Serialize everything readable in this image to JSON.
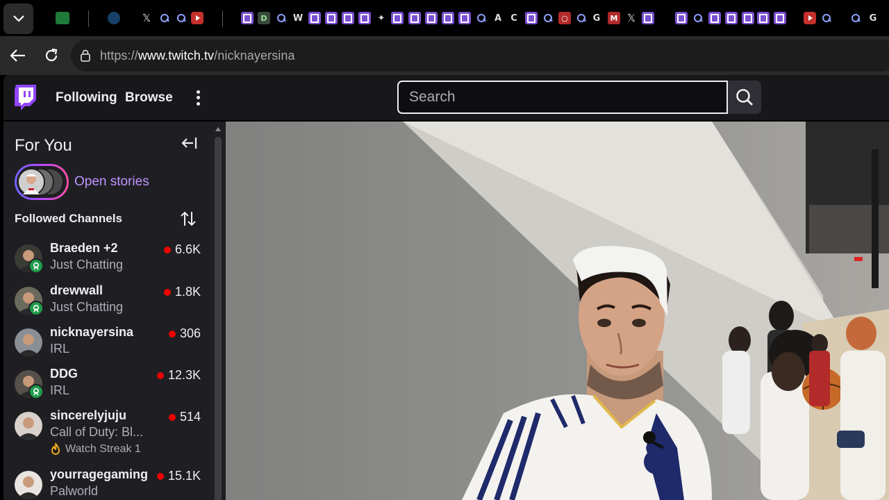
{
  "browser": {
    "url_prefix": "https://",
    "url_host": "www.twitch.tv",
    "url_path": "/nicknayersina",
    "tabs": [
      {
        "icon": "sheets-icon"
      },
      {
        "icon": "globe-icon"
      },
      {
        "icon": "x-icon"
      },
      {
        "icon": "search-icon"
      },
      {
        "icon": "search-icon"
      },
      {
        "icon": "youtube-icon"
      },
      {
        "icon": "twitch-icon"
      },
      {
        "icon": "d-icon"
      },
      {
        "icon": "search-icon"
      },
      {
        "icon": "willy-icon"
      },
      {
        "icon": "twitch-icon"
      },
      {
        "icon": "twitch-icon"
      },
      {
        "icon": "twitch-icon"
      },
      {
        "icon": "twitch-icon"
      },
      {
        "icon": "bird-icon"
      },
      {
        "icon": "twitch-icon"
      },
      {
        "icon": "twitch-icon"
      },
      {
        "icon": "twitch-icon"
      },
      {
        "icon": "twitch-icon"
      },
      {
        "icon": "twitch-icon"
      },
      {
        "icon": "search-icon"
      },
      {
        "icon": "a-icon"
      },
      {
        "icon": "c-icon"
      },
      {
        "icon": "twitch-icon"
      },
      {
        "icon": "search-icon"
      },
      {
        "icon": "toyota-icon"
      },
      {
        "icon": "search-icon"
      },
      {
        "icon": "gmc-icon"
      },
      {
        "icon": "n-icon"
      },
      {
        "icon": "x-icon"
      },
      {
        "icon": "twitch-icon"
      },
      {
        "icon": "twitch-icon"
      },
      {
        "icon": "search-icon"
      },
      {
        "icon": "twitch-icon"
      },
      {
        "icon": "twitch-icon"
      },
      {
        "icon": "twitch-icon"
      },
      {
        "icon": "twitch-icon"
      },
      {
        "icon": "twitch-icon"
      },
      {
        "icon": "youtube-icon"
      },
      {
        "icon": "search-icon"
      },
      {
        "icon": "search-icon"
      },
      {
        "icon": "g-icon"
      }
    ]
  },
  "nav": {
    "following": "Following",
    "browse": "Browse",
    "search_placeholder": "Search"
  },
  "sidebar": {
    "for_you": "For You",
    "open_stories": "Open stories",
    "followed_channels": "Followed Channels",
    "channels": [
      {
        "name": "Braeden +2",
        "game": "Just Chatting",
        "viewers": "6.6K",
        "badge": true,
        "avatar_color": "#3b3b36"
      },
      {
        "name": "drewwall",
        "game": "Just Chatting",
        "viewers": "1.8K",
        "badge": true,
        "avatar_color": "#6a6a5c"
      },
      {
        "name": "nicknayersina",
        "game": "IRL",
        "viewers": "306",
        "badge": false,
        "avatar_color": "#8a8f96"
      },
      {
        "name": "DDG",
        "game": "IRL",
        "viewers": "12.3K",
        "badge": true,
        "avatar_color": "#55504a"
      },
      {
        "name": "sincerelyjuju",
        "game": "Call of Duty: Bl...",
        "viewers": "514",
        "badge": false,
        "avatar_color": "#d9d2cc",
        "streak": "Watch Streak 1"
      },
      {
        "name": "yourragegaming",
        "game": "Palworld",
        "viewers": "15.1K",
        "badge": false,
        "avatar_color": "#e9e4e1"
      }
    ]
  },
  "colors": {
    "twitch_purple": "#9146ff",
    "live_red": "#eb0400",
    "link_purple": "#bf94ff",
    "sidebar_bg": "#1f1f23",
    "nav_bg": "#18181b"
  }
}
